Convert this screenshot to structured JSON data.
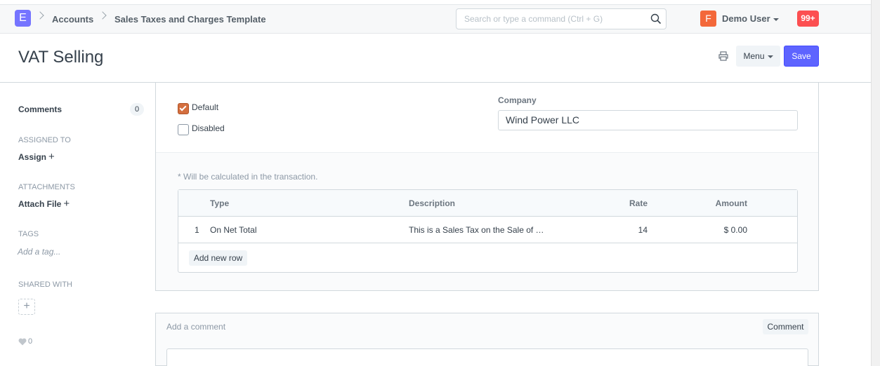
{
  "navbar": {
    "logo_letter": "E",
    "breadcrumbs": [
      "Accounts",
      "Sales Taxes and Charges Template"
    ],
    "search_placeholder": "Search or type a command (Ctrl + G)",
    "user_initial": "F",
    "user_name": "Demo User",
    "notification_count": "99+"
  },
  "page": {
    "title": "VAT Selling",
    "menu_label": "Menu",
    "save_label": "Save"
  },
  "sidebar": {
    "comments_label": "Comments",
    "comments_count": "0",
    "assigned_to_label": "ASSIGNED TO",
    "assign_label": "Assign",
    "attachments_label": "ATTACHMENTS",
    "attach_label": "Attach File",
    "tags_label": "TAGS",
    "add_tag_label": "Add a tag...",
    "shared_with_label": "SHARED WITH",
    "likes_count": "0"
  },
  "form": {
    "default_label": "Default",
    "default_checked": true,
    "disabled_label": "Disabled",
    "disabled_checked": false,
    "company_label": "Company",
    "company_value": "Wind Power LLC",
    "help_text": "* Will be calculated in the transaction.",
    "grid": {
      "columns": [
        "Type",
        "Description",
        "Rate",
        "Amount"
      ],
      "rows": [
        {
          "idx": "1",
          "type": "On Net Total",
          "description": "This is a Sales Tax on the Sale of …",
          "rate": "14",
          "amount": "$ 0.00"
        }
      ],
      "add_row_label": "Add new row"
    }
  },
  "comment": {
    "placeholder": "Add a comment",
    "button_label": "Comment"
  },
  "colors": {
    "primary": "#5e64ff",
    "logo": "#7574ff",
    "avatar": "#f3683a",
    "notification": "#fc4f51",
    "checkbox_checked": "#d46f3f"
  }
}
